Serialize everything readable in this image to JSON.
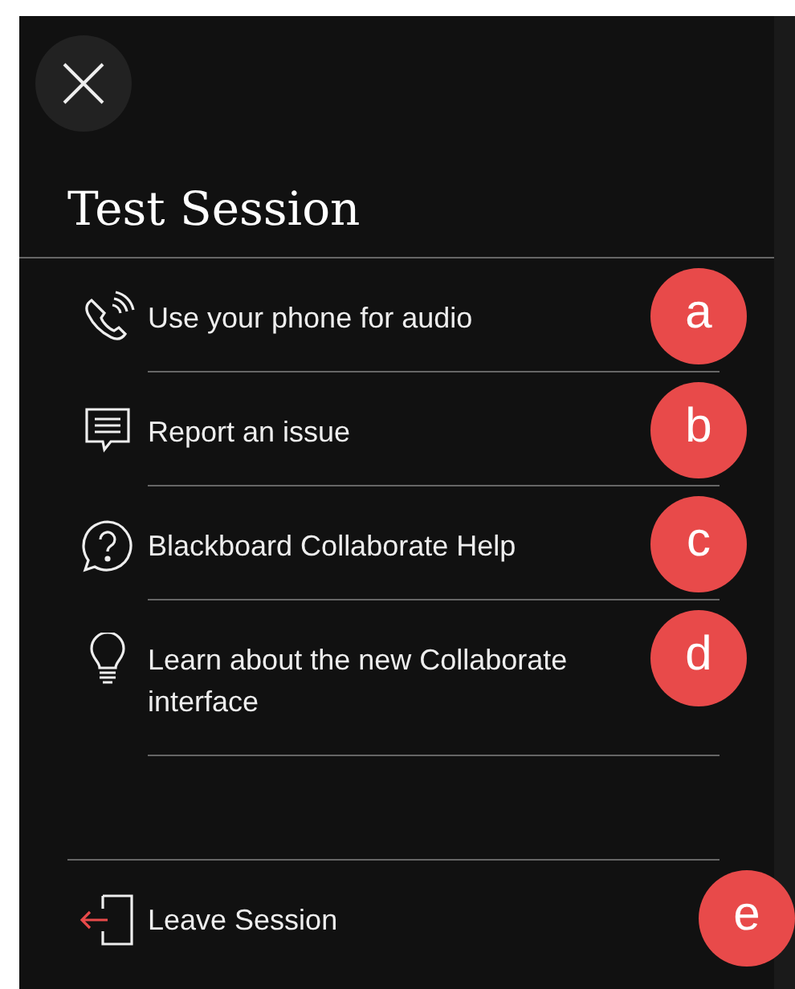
{
  "panel": {
    "title": "Test Session"
  },
  "menu_items": [
    {
      "kind": "phone",
      "label": "Use your phone for audio",
      "marker": "a"
    },
    {
      "kind": "report",
      "label": "Report an issue",
      "marker": "b"
    },
    {
      "kind": "help",
      "label": "Blackboard Collaborate Help",
      "marker": "c"
    },
    {
      "kind": "bulb",
      "label": "Learn about the new Collaborate interface",
      "marker": "d"
    }
  ],
  "leave_item": {
    "kind": "leave",
    "label": "Leave Session",
    "marker": "e"
  }
}
